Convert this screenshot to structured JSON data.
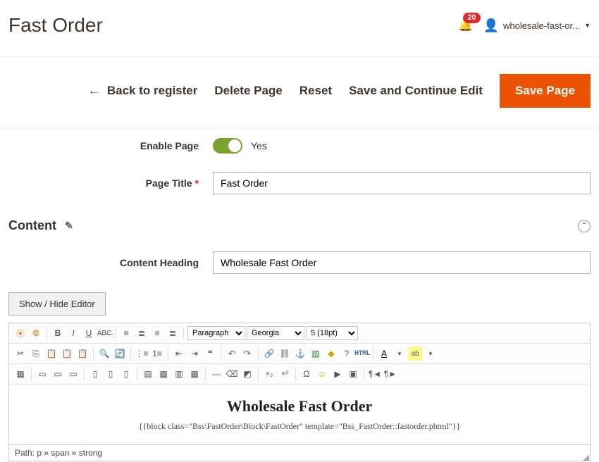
{
  "header": {
    "title": "Fast Order",
    "notifications": "20",
    "user": "wholesale-fast-or...",
    "caret": "▼"
  },
  "actions": {
    "back": "Back to register",
    "delete": "Delete Page",
    "reset": "Reset",
    "saveContinue": "Save and Continue Edit",
    "save": "Save Page"
  },
  "form": {
    "enable_label": "Enable Page",
    "enable_value": "Yes",
    "title_label": "Page Title",
    "title_value": "Fast Order"
  },
  "content": {
    "section_label": "Content",
    "heading_label": "Content Heading",
    "heading_value": "Wholesale Fast Order",
    "show_hide": "Show / Hide Editor"
  },
  "toolbar": {
    "format_select": "Paragraph",
    "font_select": "Georgia",
    "size_select": "5 (18pt)",
    "html_label": "HTML",
    "A_char": "A"
  },
  "editor_body": {
    "heading": "Wholesale Fast Order",
    "code": "{{block class=\"Bss\\FastOrder\\Block\\FastOrder\" template=\"Bss_FastOrder::fastorder.phtml\"}}"
  },
  "path": "Path: p » span » strong"
}
